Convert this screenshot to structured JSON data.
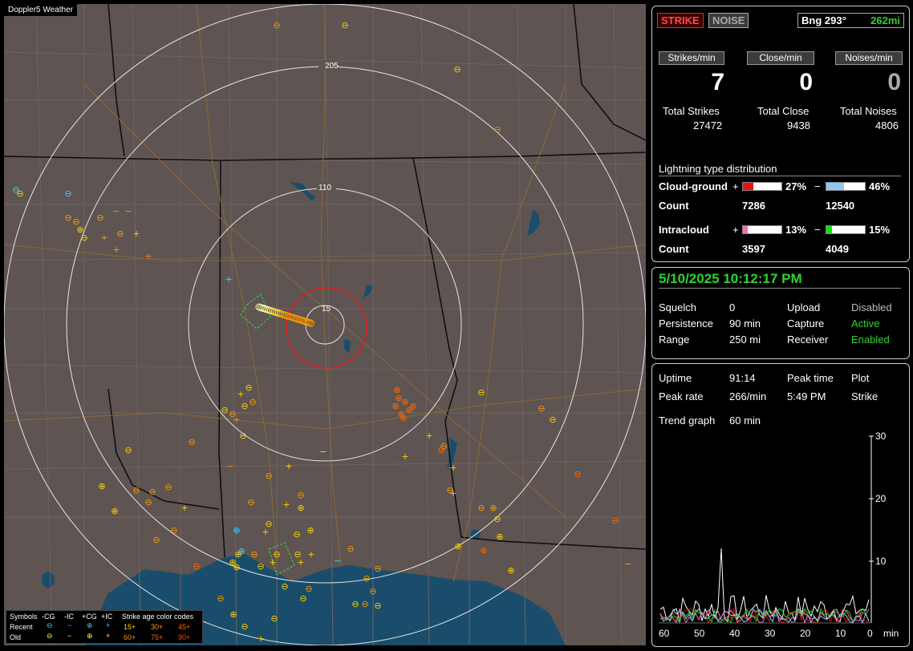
{
  "app": {
    "brand": "Doppler5 Weather"
  },
  "map": {
    "ring_labels": [
      "205",
      "110",
      "15"
    ],
    "legend": {
      "header_symbols": "Symbols",
      "cols": [
        "-CG",
        "-IC",
        "+CG",
        "+IC"
      ],
      "header_age": "Strike age color codes",
      "row_recent": "Recent",
      "row_old": "Old",
      "recent_ages": [
        "15+",
        "30+",
        "45+"
      ],
      "old_ages": [
        "60+",
        "75+",
        "90+"
      ],
      "recent_age_colors": [
        "#ffd200",
        "#ff9a00",
        "#ff6a00"
      ],
      "old_age_colors": [
        "#ff8a00",
        "#ff6000",
        "#ff4a00"
      ]
    }
  },
  "status": {
    "strike_chip": "STRIKE",
    "noise_chip": "NOISE",
    "bearing": "Bng 293°",
    "distance": "262mi",
    "rate_labels": [
      "Strikes/min",
      "Close/min",
      "Noises/min"
    ],
    "rate_values": [
      "7",
      "0",
      "0"
    ],
    "total_labels": [
      "Total Strikes",
      "Total Close",
      "Total Noises"
    ],
    "total_values": [
      "27472",
      "9438",
      "4806"
    ]
  },
  "distribution": {
    "title": "Lightning type distribution",
    "cg_label": "Cloud-ground",
    "ic_label": "Intracloud",
    "count_label": "Count",
    "plus": "+",
    "minus": "−",
    "cg_pos_pct": "27%",
    "cg_neg_pct": "46%",
    "cg_pos_count": "7286",
    "cg_neg_count": "12540",
    "ic_pos_pct": "13%",
    "ic_neg_pct": "15%",
    "ic_pos_count": "3597",
    "ic_neg_count": "4049",
    "fills": {
      "cg_pos": 0.27,
      "cg_neg": 0.46,
      "ic_pos": 0.13,
      "ic_neg": 0.15
    },
    "colors": {
      "cg_pos": "#e81010",
      "cg_neg": "#8cc8f0",
      "ic_pos": "#f070b0",
      "ic_neg": "#10e010"
    }
  },
  "settings": {
    "datetime": "5/10/2025 10:12:17 PM",
    "squelch_label": "Squelch",
    "squelch": "0",
    "persistence_label": "Persistence",
    "persistence": "90 min",
    "range_label": "Range",
    "range": "250 mi",
    "upload_label": "Upload",
    "upload": "Disabled",
    "capture_label": "Capture",
    "capture": "Active",
    "receiver_label": "Receiver",
    "receiver": "Enabled"
  },
  "trend": {
    "uptime_label": "Uptime",
    "uptime": "91:14",
    "peak_time_label": "Peak time",
    "peak_time": "5:49 PM",
    "plot_label": "Plot",
    "plot": "Strike",
    "peak_rate_label": "Peak rate",
    "peak_rate": "266/min",
    "trend_label": "Trend graph",
    "trend": "60 min",
    "y_ticks": [
      "30",
      "20",
      "10"
    ],
    "x_ticks": [
      "60",
      "50",
      "40",
      "30",
      "20",
      "10",
      "0"
    ],
    "x_unit": "min"
  }
}
